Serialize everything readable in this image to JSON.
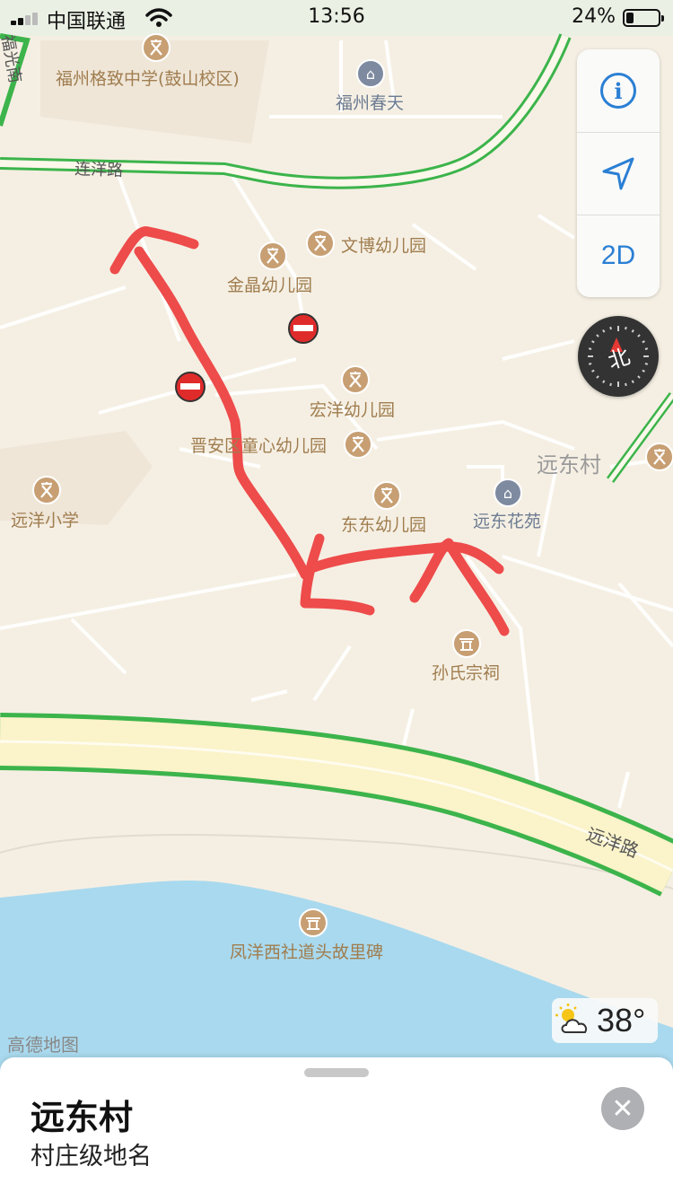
{
  "status_bar": {
    "carrier": "中国联通",
    "time": "13:56",
    "battery_percent": "24%",
    "battery_level": 0.24,
    "signal_bars": 2
  },
  "map": {
    "roads": [
      {
        "name": "连洋路"
      },
      {
        "name": "远洋路"
      }
    ],
    "pois": [
      {
        "label": "福州格致中学(鼓山校区)",
        "icon": "school-icon"
      },
      {
        "label": "福州春天",
        "icon": "building-icon"
      },
      {
        "label": "文博幼儿园",
        "icon": "school-icon"
      },
      {
        "label": "金晶幼儿园",
        "icon": "school-icon"
      },
      {
        "label": "宏洋幼儿园",
        "icon": "school-icon"
      },
      {
        "label": "晋安区童心幼儿园",
        "icon": "school-icon"
      },
      {
        "label": "远洋小学",
        "icon": "school-icon"
      },
      {
        "label": "东东幼儿园",
        "icon": "school-icon"
      },
      {
        "label": "远东花苑",
        "icon": "building-icon"
      },
      {
        "label": "孙氏宗祠",
        "icon": "temple-icon"
      },
      {
        "label": "凤洋西社道头故里碑",
        "icon": "temple-icon"
      }
    ],
    "area_label": "远东村",
    "edge_label": "福光南",
    "colors": {
      "land": "#f5efe3",
      "water": "#a9d9ee",
      "road_outline": "#3cb44b",
      "highway": "#fbf3c9",
      "annotation": "#ee4b4b",
      "poi_icon": "#c79f73"
    }
  },
  "controls": {
    "info_label": "i",
    "location_icon": "location-arrow-icon",
    "mode_label": "2D"
  },
  "compass": {
    "label": "北"
  },
  "weather": {
    "temperature": "38°",
    "icon": "partly-sunny-icon"
  },
  "attribution": "高德地图",
  "place_card": {
    "title": "远东村",
    "subtitle": "村庄级地名",
    "close_icon": "close-icon"
  }
}
